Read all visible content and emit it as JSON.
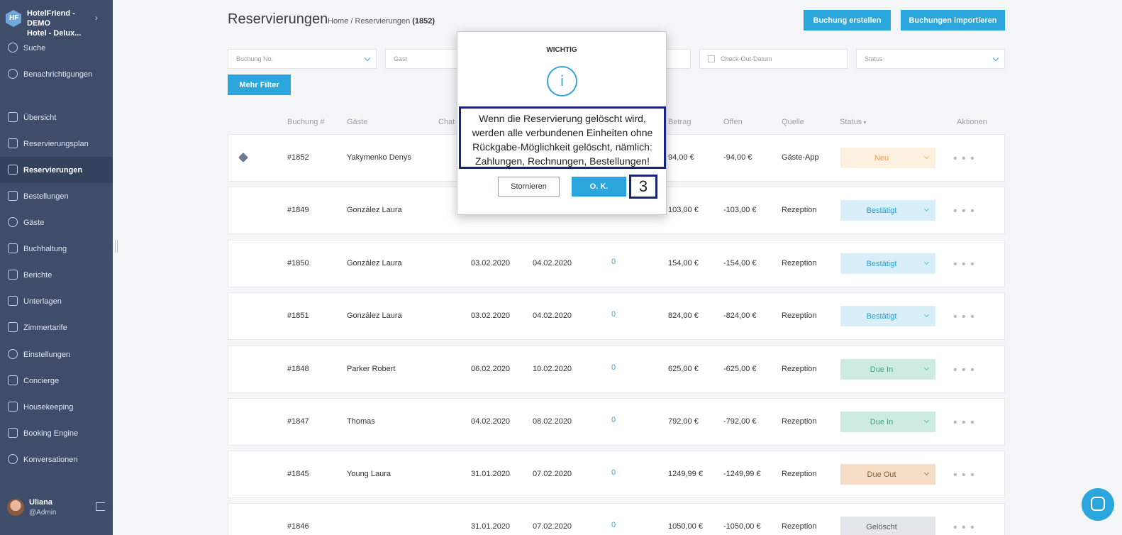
{
  "hotel": {
    "name_line1": "HotelFriend - DEMO",
    "name_line2": "Hotel - Delux..."
  },
  "sidebar": {
    "items": [
      {
        "label": "Suche",
        "icon": "search-icon"
      },
      {
        "label": "Benachrichtigungen",
        "icon": "bell-icon"
      },
      {
        "label": "Übersicht",
        "icon": "home-icon"
      },
      {
        "label": "Reservierungsplan",
        "icon": "calendar-icon"
      },
      {
        "label": "Reservierungen",
        "icon": "clipboard-icon",
        "active": true
      },
      {
        "label": "Bestellungen",
        "icon": "cloche-icon"
      },
      {
        "label": "Gäste",
        "icon": "person-icon"
      },
      {
        "label": "Buchhaltung",
        "icon": "calculator-icon"
      },
      {
        "label": "Berichte",
        "icon": "document-icon"
      },
      {
        "label": "Unterlagen",
        "icon": "folder-icon"
      },
      {
        "label": "Zimmertarife",
        "icon": "rates-icon"
      },
      {
        "label": "Einstellungen",
        "icon": "gear-icon"
      },
      {
        "label": "Concierge",
        "icon": "concierge-icon"
      },
      {
        "label": "Housekeeping",
        "icon": "broom-icon"
      },
      {
        "label": "Booking Engine",
        "icon": "browser-icon"
      },
      {
        "label": "Konversationen",
        "icon": "chat-icon"
      }
    ],
    "user": {
      "name": "Uliana",
      "role": "@Admin"
    }
  },
  "header": {
    "title": "Reservierungen",
    "breadcrumb_home": "Home",
    "breadcrumb_sep": "/",
    "breadcrumb_current": "Reservierungen",
    "breadcrumb_count": "(1852)",
    "create_button": "Buchung erstellen",
    "import_button": "Buchungen importieren"
  },
  "filters": {
    "booking_no": "Buchung No.",
    "guest": "Gast",
    "checkout": "Check-Out-Datum",
    "status": "Status",
    "more_filter": "Mehr Filter"
  },
  "table": {
    "headers": {
      "booking": "Buchung #",
      "guests": "Gäste",
      "chat": "Chat",
      "amount": "Betrag",
      "open": "Offen",
      "source": "Quelle",
      "status": "Status",
      "actions": "Aktionen"
    },
    "rows": [
      {
        "tag": true,
        "id": "#1852",
        "guest": "Yakymenko Denys",
        "checkin": "",
        "checkout": "",
        "chat": "",
        "amount": "94,00 €",
        "open": "-94,00 €",
        "source": "Gäste-App",
        "status": "Neu",
        "status_bg": "#fdf0df",
        "status_fg": "#f0a04b"
      },
      {
        "tag": false,
        "id": "#1849",
        "guest": "González Laura",
        "checkin": "",
        "checkout": "",
        "chat": "",
        "amount": "103,00 €",
        "open": "-103,00 €",
        "source": "Rezeption",
        "status": "Bestätigt",
        "status_bg": "#d8eef8",
        "status_fg": "#2a9fd6"
      },
      {
        "tag": false,
        "id": "#1850",
        "guest": "González Laura",
        "checkin": "03.02.2020",
        "checkout": "04.02.2020",
        "chat": "0",
        "amount": "154,00 €",
        "open": "-154,00 €",
        "source": "Rezeption",
        "status": "Bestätigt",
        "status_bg": "#d8eef8",
        "status_fg": "#2a9fd6"
      },
      {
        "tag": false,
        "id": "#1851",
        "guest": "González Laura",
        "checkin": "03.02.2020",
        "checkout": "04.02.2020",
        "chat": "0",
        "amount": "824,00 €",
        "open": "-824,00 €",
        "source": "Rezeption",
        "status": "Bestätigt",
        "status_bg": "#d8eef8",
        "status_fg": "#2a9fd6"
      },
      {
        "tag": false,
        "id": "#1848",
        "guest": "Parker Robert",
        "checkin": "06.02.2020",
        "checkout": "10.02.2020",
        "chat": "0",
        "amount": "625,00 €",
        "open": "-625,00 €",
        "source": "Rezeption",
        "status": "Due In",
        "status_bg": "#cdebe0",
        "status_fg": "#3aa380"
      },
      {
        "tag": false,
        "id": "#1847",
        "guest": "Thomas",
        "checkin": "04.02.2020",
        "checkout": "08.02.2020",
        "chat": "0",
        "amount": "792,00 €",
        "open": "-792,00 €",
        "source": "Rezeption",
        "status": "Due In",
        "status_bg": "#cdebe0",
        "status_fg": "#3aa380"
      },
      {
        "tag": false,
        "id": "#1845",
        "guest": "Young Laura",
        "checkin": "31.01.2020",
        "checkout": "07.02.2020",
        "chat": "0",
        "amount": "1249,99 €",
        "open": "-1249,99 €",
        "source": "Rezeption",
        "status": "Due Out",
        "status_bg": "#f4dcc7",
        "status_fg": "#8a5a30"
      },
      {
        "tag": false,
        "id": "#1846",
        "guest": "",
        "checkin": "31.01.2020",
        "checkout": "07.02.2020",
        "chat": "0",
        "amount": "1050,00 €",
        "open": "-1050,00 €",
        "source": "Rezeption",
        "status": "Gelöscht",
        "status_bg": "#e3e6ea",
        "status_fg": "#555b66"
      }
    ]
  },
  "modal": {
    "title": "WICHTIG",
    "message": "Wenn die Reservierung gelöscht wird, werden alle verbundenen Einheiten ohne Rückgabe-Möglichkeit gelöscht, nämlich: Zahlungen, Rechnungen, Bestellungen!",
    "cancel": "Stornieren",
    "ok": "O. K.",
    "step": "3"
  },
  "colors": {
    "accent": "#2aa6dc",
    "sidebar": "#3f4d6b",
    "annotation": "#1a237e"
  }
}
